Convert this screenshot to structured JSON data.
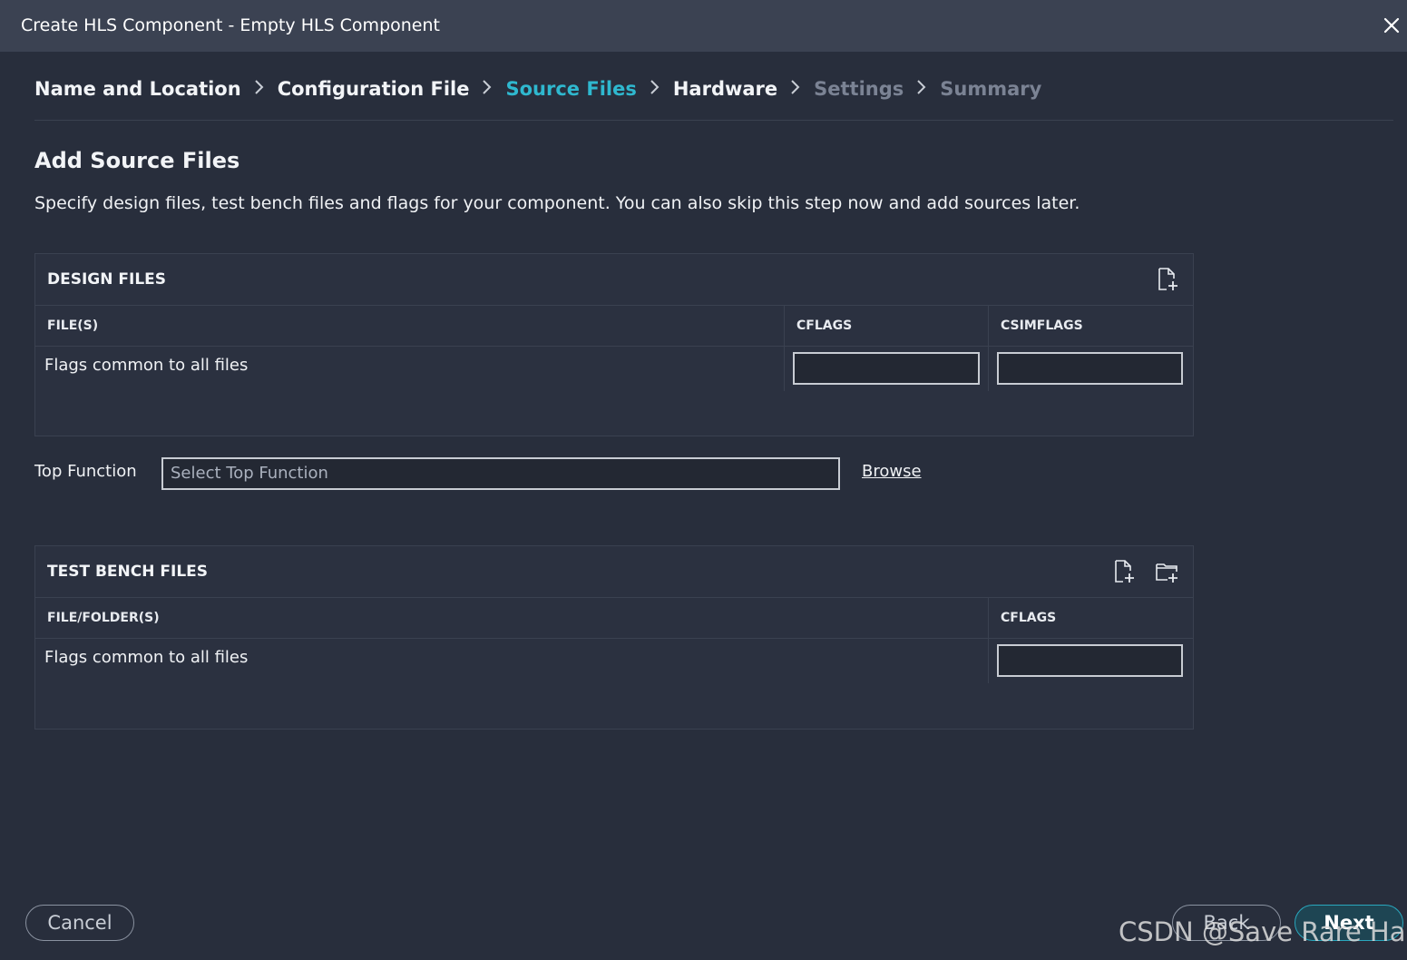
{
  "window": {
    "title": "Create HLS Component - Empty HLS Component",
    "close_icon": "close-icon"
  },
  "breadcrumb": {
    "steps": [
      {
        "label": "Name and Location",
        "state": "completed"
      },
      {
        "label": "Configuration File",
        "state": "completed"
      },
      {
        "label": "Source Files",
        "state": "active"
      },
      {
        "label": "Hardware",
        "state": "completed"
      },
      {
        "label": "Settings",
        "state": "disabled"
      },
      {
        "label": "Summary",
        "state": "disabled"
      }
    ],
    "separator_icon": "chevron-right-icon"
  },
  "page": {
    "heading": "Add Source Files",
    "description": "Specify design files, test bench files and flags for your component. You can also skip this step now and add sources later."
  },
  "design_files": {
    "title": "DESIGN FILES",
    "add_icon": "add-file-icon",
    "columns": [
      "FILE(S)",
      "CFLAGS",
      "CSIMFLAGS"
    ],
    "rows": [
      {
        "label": "Flags common to all files",
        "cflags": "",
        "csimflags": ""
      }
    ]
  },
  "top_function": {
    "label": "Top Function",
    "placeholder": "Select Top Function",
    "value": "",
    "browse_label": "Browse"
  },
  "test_bench_files": {
    "title": "TEST BENCH FILES",
    "add_file_icon": "add-file-icon",
    "add_folder_icon": "add-folder-icon",
    "columns": [
      "FILE/FOLDER(S)",
      "CFLAGS"
    ],
    "rows": [
      {
        "label": "Flags common to all files",
        "cflags": ""
      }
    ]
  },
  "footer": {
    "cancel_label": "Cancel",
    "back_label": "Back",
    "next_label": "Next"
  },
  "watermark": "CSDN @Save Rare Hair",
  "colors": {
    "accent": "#2fb8cf",
    "background": "#282e3c",
    "titlebar": "#3b4252",
    "disabled_text": "#7b8394"
  }
}
